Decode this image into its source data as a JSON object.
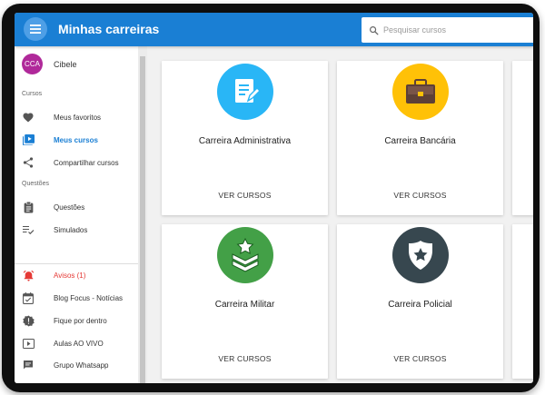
{
  "header": {
    "title": "Minhas carreiras",
    "search_placeholder": "Pesquisar cursos"
  },
  "user": {
    "initials": "CCA",
    "name": "Cibele"
  },
  "sidebar": {
    "section_cursos": "Cursos",
    "section_questoes": "Questões",
    "items": [
      {
        "label": "Meus favoritos",
        "icon": "heart-icon"
      },
      {
        "label": "Meus cursos",
        "icon": "play-box-icon",
        "active": true
      },
      {
        "label": "Compartilhar cursos",
        "icon": "share-icon"
      },
      {
        "label": "Questões",
        "icon": "clipboard-icon"
      },
      {
        "label": "Simulados",
        "icon": "checklist-icon"
      },
      {
        "label": "Avisos (1)",
        "icon": "alarm-icon",
        "alert": true
      },
      {
        "label": "Blog Focus - Notícias",
        "icon": "calendar-check-icon"
      },
      {
        "label": "Fique por dentro",
        "icon": "alert-badge-icon"
      },
      {
        "label": "Aulas AO VIVO",
        "icon": "live-play-icon"
      },
      {
        "label": "Grupo Whatsapp",
        "icon": "chat-icon"
      }
    ]
  },
  "cards": [
    {
      "title": "Carreira Administrativa",
      "button": "VER CURSOS",
      "icon": "document-edit-icon",
      "color": "#29b6f6"
    },
    {
      "title": "Carreira Bancária",
      "button": "VER CURSOS",
      "icon": "briefcase-icon",
      "color": "#ffc107"
    },
    {
      "title": "Carreira Militar",
      "button": "VER CURSOS",
      "icon": "military-rank-icon",
      "color": "#43a047"
    },
    {
      "title": "Carreira Policial",
      "button": "VER CURSOS",
      "icon": "police-badge-icon",
      "color": "#37474f"
    }
  ],
  "colors": {
    "primary": "#1a7fd4",
    "alert": "#e53935"
  }
}
